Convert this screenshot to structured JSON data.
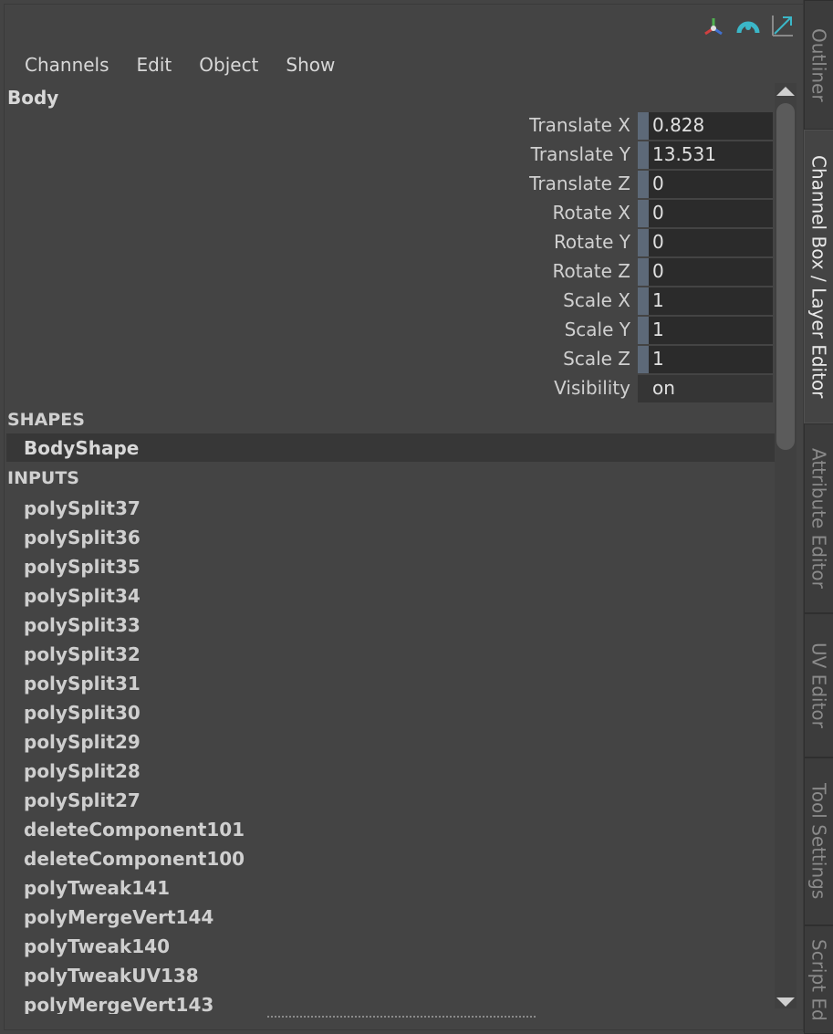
{
  "menu": [
    "Channels",
    "Edit",
    "Object",
    "Show"
  ],
  "icons": [
    "transform-axes-icon",
    "arc-teal-icon",
    "resize-arrow-icon"
  ],
  "node": {
    "title": "Body"
  },
  "attributes": [
    {
      "label": "Translate X",
      "value": "0.828",
      "keyed": true
    },
    {
      "label": "Translate Y",
      "value": "13.531",
      "keyed": true
    },
    {
      "label": "Translate Z",
      "value": "0",
      "keyed": true
    },
    {
      "label": "Rotate X",
      "value": "0",
      "keyed": true
    },
    {
      "label": "Rotate Y",
      "value": "0",
      "keyed": true
    },
    {
      "label": "Rotate Z",
      "value": "0",
      "keyed": true
    },
    {
      "label": "Scale X",
      "value": "1",
      "keyed": true
    },
    {
      "label": "Scale Y",
      "value": "1",
      "keyed": true
    },
    {
      "label": "Scale Z",
      "value": "1",
      "keyed": true
    },
    {
      "label": "Visibility",
      "value": "on",
      "keyed": false
    }
  ],
  "shapes": {
    "header": "SHAPES",
    "items": [
      "BodyShape"
    ]
  },
  "inputs": {
    "header": "INPUTS",
    "items": [
      "polySplit37",
      "polySplit36",
      "polySplit35",
      "polySplit34",
      "polySplit33",
      "polySplit32",
      "polySplit31",
      "polySplit30",
      "polySplit29",
      "polySplit28",
      "polySplit27",
      "deleteComponent101",
      "deleteComponent100",
      "polyTweak141",
      "polyMergeVert144",
      "polyTweak140",
      "polyTweakUV138",
      "polyMergeVert143"
    ]
  },
  "side_tabs": [
    {
      "label": "Outliner",
      "active": false
    },
    {
      "label": "Channel Box / Layer Editor",
      "active": true
    },
    {
      "label": "Attribute Editor",
      "active": false
    },
    {
      "label": "UV Editor",
      "active": false
    },
    {
      "label": "Tool Settings",
      "active": false
    },
    {
      "label": "Script Ed",
      "active": false
    }
  ],
  "colors": {
    "background": "#444444",
    "field": "#2b2b2b",
    "key_marker": "#5d6978",
    "accent_teal": "#3bb7c8"
  }
}
